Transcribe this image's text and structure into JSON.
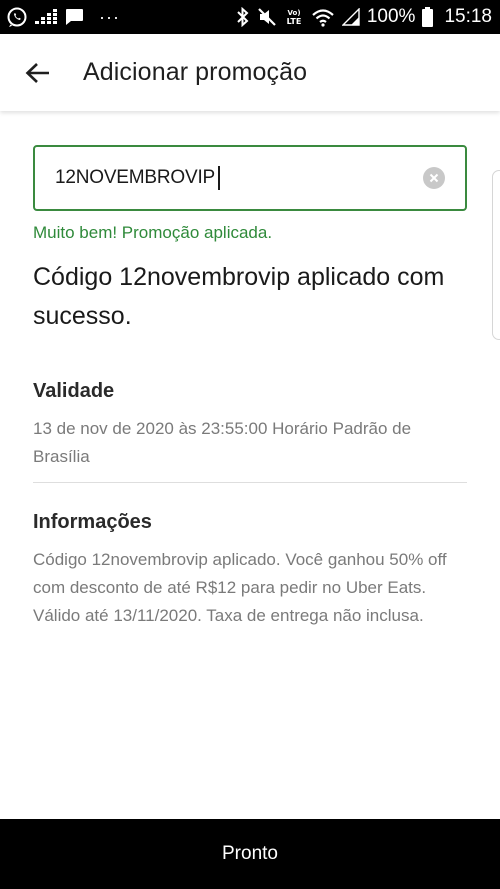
{
  "status_bar": {
    "battery_percent": "100%",
    "time": "15:18",
    "overflow_dots": "···",
    "left_icons": [
      "whatsapp-icon",
      "deezer-icon",
      "message-icon"
    ],
    "right_icons": [
      "bluetooth-icon",
      "mute-icon",
      "volte-icon",
      "wifi-icon",
      "signal-icon",
      "battery-icon"
    ]
  },
  "app_bar": {
    "title": "Adicionar promoção",
    "back_icon": "arrow-left-icon"
  },
  "promo": {
    "input_value": "12NOVEMBROVIP",
    "clear_icon": "clear-circle-icon",
    "success_message": "Muito bem! Promoção aplicada.",
    "heading": "Código 12novembrovip aplicado com sucesso."
  },
  "validity": {
    "heading": "Validade",
    "text": "13 de nov de 2020 às 23:55:00 Horário Padrão de Brasília"
  },
  "info": {
    "heading": "Informações",
    "text": "Código 12novembrovip aplicado. Você ganhou 50% off com desconto de até R$12 para pedir no Uber Eats. Válido até 13/11/2020. Taxa de entrega não inclusa."
  },
  "footer": {
    "done_label": "Pronto"
  },
  "colors": {
    "accent_green": "#3a8a3f",
    "success_text": "#2f8a3a",
    "button_bg": "#000000",
    "muted_text": "#7a7a7a"
  }
}
